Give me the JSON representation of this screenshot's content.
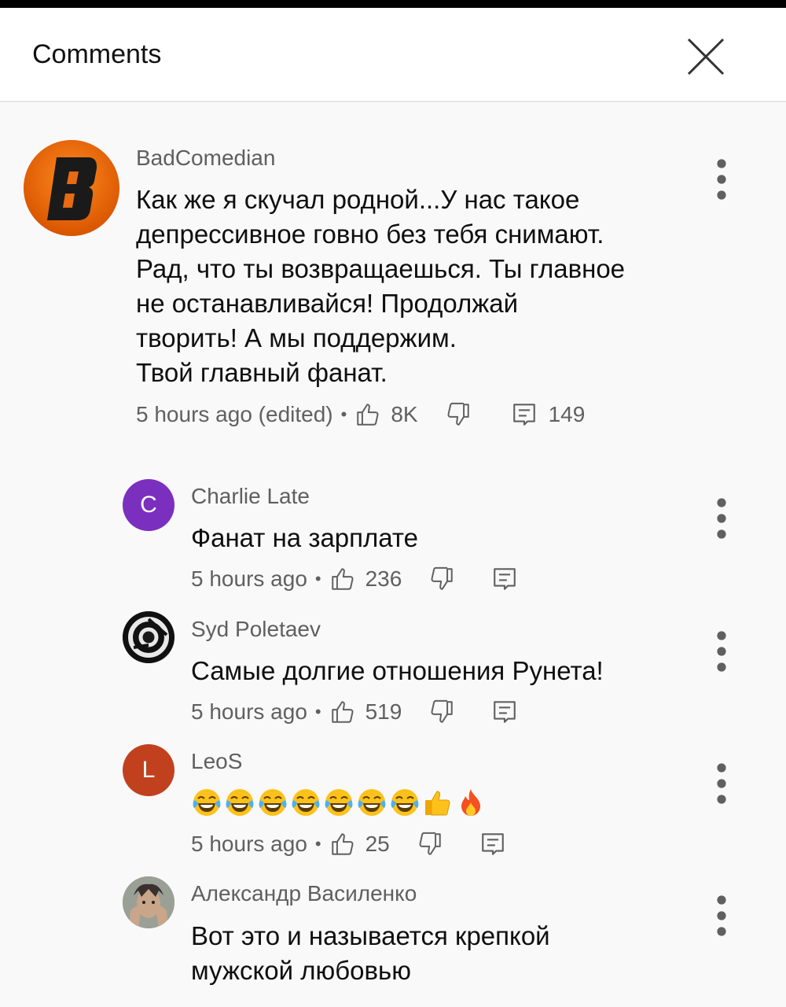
{
  "header": {
    "title": "Comments"
  },
  "colors": {
    "text_primary": "#0f0f0f",
    "text_secondary": "#606060",
    "avatar_charlie": "#7b2fbf",
    "avatar_leos": "#c1411f",
    "avatar_badcomedian": "#e86a12"
  },
  "main_comment": {
    "author": "BadComedian",
    "avatar_letter": "B",
    "text": "Как же я скучал родной...У нас такое\nдепрессивное говно без тебя снимают.\nРад, что ты возвращаешься. Ты главное\nне останавливайся! Продолжай\nтворить! А мы поддержим.\nТвой главный фанат.",
    "time": "5 hours ago (edited)",
    "likes": "8K",
    "replies": "149"
  },
  "replies": [
    {
      "author": "Charlie Late",
      "avatar_letter": "C",
      "text": "Фанат на зарплате",
      "time": "5 hours ago",
      "likes": "236"
    },
    {
      "author": "Syd Poletaev",
      "avatar_icon": "chrome-style-logo",
      "text": "Самые долгие отношения Рунета!",
      "time": "5 hours ago",
      "likes": "519"
    },
    {
      "author": "LeoS",
      "avatar_letter": "L",
      "text": "",
      "emoji": [
        "face-with-tears-of-joy",
        "face-with-tears-of-joy",
        "face-with-tears-of-joy",
        "face-with-tears-of-joy",
        "face-with-tears-of-joy",
        "face-with-tears-of-joy",
        "face-with-tears-of-joy",
        "thumbs-up",
        "fire"
      ],
      "time": "5 hours ago",
      "likes": "25"
    },
    {
      "author": "Александр Василенко",
      "avatar_icon": "photo",
      "text": "Вот это и называется крепкой\nмужской любовью",
      "time": "",
      "likes": ""
    }
  ]
}
